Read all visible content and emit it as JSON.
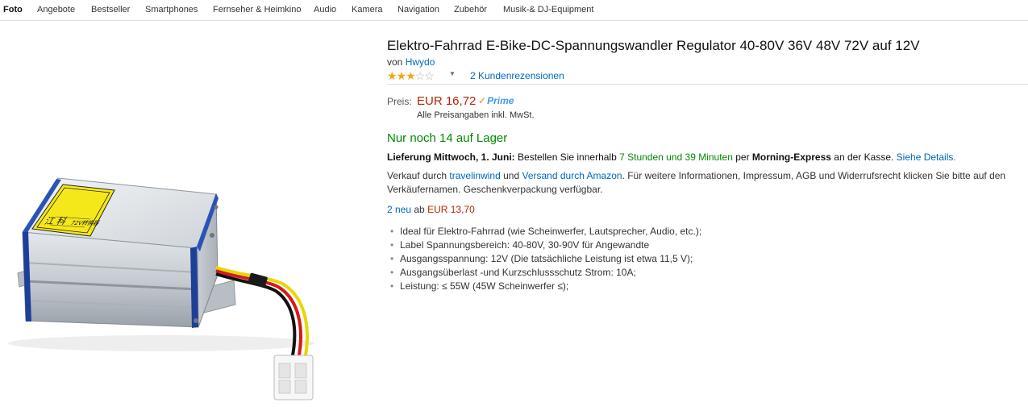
{
  "nav": {
    "items": [
      "Foto",
      "Angebote",
      "Bestseller",
      "Smartphones",
      "Fernseher & Heimkino",
      "Audio",
      "Kamera",
      "Navigation",
      "Zubehör",
      "Musik-& DJ-Equipment"
    ],
    "active_index": 0
  },
  "product": {
    "title": "Elektro-Fahrrad E-Bike-DC-Spannungswandler Regulator 40-80V 36V 48V 72V auf 12V",
    "by_prefix": "von",
    "brand": "Hwydo",
    "rating": {
      "stars_filled": 3,
      "stars_total": 5,
      "reviews_label": "2 Kundenrezensionen"
    },
    "device_label": {
      "chars": "江 科",
      "text": "72V转换器"
    }
  },
  "price": {
    "label": "Preis:",
    "value": "EUR 16,72",
    "prime_label": "Prime",
    "vat_note": "Alle Preisangaben inkl. MwSt."
  },
  "stock": "Nur noch 14 auf Lager",
  "delivery": {
    "lead": "Lieferung Mittwoch, 1. Juni:",
    "text1": "Bestellen Sie innerhalb",
    "countdown": "7 Stunden und 39 Minuten",
    "text2": "per",
    "method": "Morning-Express",
    "text3": "an der Kasse.",
    "details_link": "Siehe Details."
  },
  "seller": {
    "prefix": "Verkauf durch",
    "name": "travelinwind",
    "and": "und",
    "fulfillment": "Versand durch Amazon",
    "rest": ". Für weitere Informationen, Impressum, AGB und Widerrufsrecht klicken Sie bitte auf den Verkäufernamen. Geschenkverpackung verfügbar."
  },
  "offers": {
    "link": "2 neu",
    "from": "ab",
    "price": "EUR 13,70"
  },
  "features": [
    "Ideal für Elektro-Fahrrad (wie Scheinwerfer, Lautsprecher, Audio, etc.);",
    "Label Spannungsbereich: 40-80V, 30-90V für Angewandte",
    "Ausgangsspannung: 12V (Die tatsächliche Leistung ist etwa 11,5 V);",
    "Ausgangsüberlast -und Kurzschlussschutz Strom: 10A;",
    "Leistung: ≤ 55W (45W Scheinwerfer ≤);"
  ],
  "colors": {
    "price_red": "#b12704",
    "link_blue": "#0066c0",
    "stock_green": "#008a00",
    "star_gold": "#f0a80f",
    "prime_blue": "#3d9ae2"
  }
}
